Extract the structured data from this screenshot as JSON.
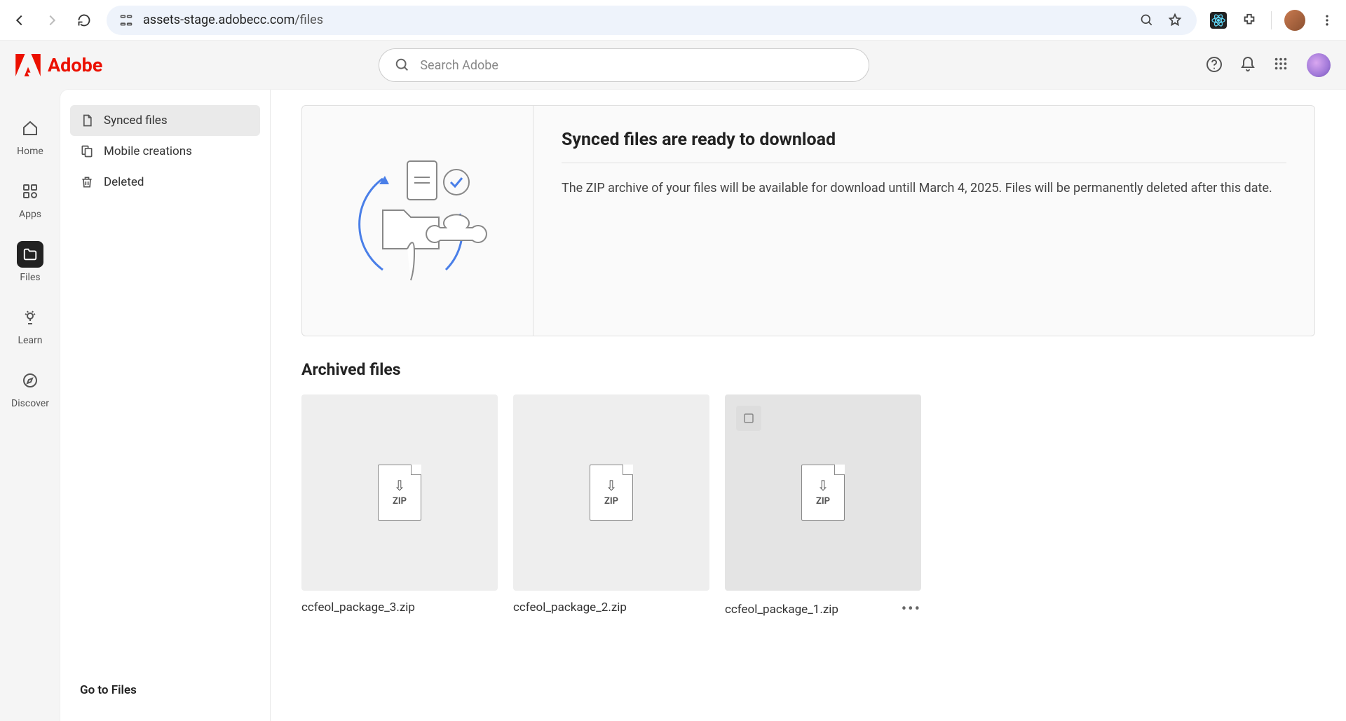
{
  "browser": {
    "url_domain": "assets-stage.adobecc.com",
    "url_path": "/files"
  },
  "brand": {
    "name": "Adobe",
    "accent": "#eb1000"
  },
  "search": {
    "placeholder": "Search Adobe"
  },
  "rail": {
    "items": [
      {
        "label": "Home"
      },
      {
        "label": "Apps"
      },
      {
        "label": "Files"
      },
      {
        "label": "Learn"
      },
      {
        "label": "Discover"
      }
    ]
  },
  "sidenav": {
    "items": [
      {
        "label": "Synced files"
      },
      {
        "label": "Mobile creations"
      },
      {
        "label": "Deleted"
      }
    ],
    "footer": "Go to Files"
  },
  "banner": {
    "title": "Synced files are ready to download",
    "body": "The ZIP archive of your files will be available for download untill March 4, 2025. Files will be permanently deleted after this date."
  },
  "section": {
    "title": "Archived files"
  },
  "files": [
    {
      "name": "ccfeol_package_3.zip",
      "type": "ZIP"
    },
    {
      "name": "ccfeol_package_2.zip",
      "type": "ZIP"
    },
    {
      "name": "ccfeol_package_1.zip",
      "type": "ZIP"
    }
  ]
}
